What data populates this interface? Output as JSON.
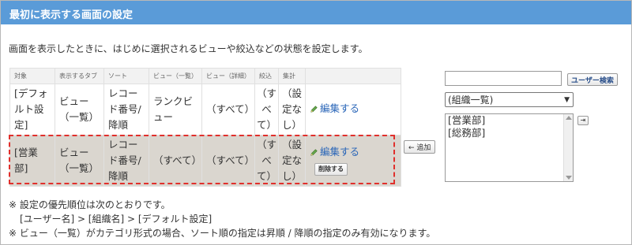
{
  "header": {
    "title": "最初に表示する画面の設定"
  },
  "intro": "画面を表示したときに、はじめに選択されるビューや絞込などの状態を設定します。",
  "table": {
    "columns": [
      "対象",
      "表示するタブ",
      "ソート",
      "ビュー（一覧）",
      "ビュー（詳細）",
      "絞込",
      "集計"
    ],
    "rows": [
      {
        "target": "[デフォルト設定]",
        "tab": "ビュー（一覧）",
        "sort": "レコード番号/ 降順",
        "view_list": "ランクビュー",
        "view_detail": "（すべて）",
        "filter": "（すべて）",
        "aggregate": "（設定なし）",
        "edit": "編集する"
      },
      {
        "target": "[営業部]",
        "tab": "ビュー（一覧）",
        "sort": "レコード番号/ 降順",
        "view_list": "（すべて）",
        "view_detail": "（すべて）",
        "filter": "（すべて）",
        "aggregate": "（設定なし）",
        "edit": "編集する",
        "delete": "削除する"
      }
    ]
  },
  "add_button": "← 追加",
  "user_search": {
    "value": "",
    "button": "ユーザー検索"
  },
  "org_select": {
    "selected": "(組織一覧)"
  },
  "org_list": {
    "items": [
      "[営業部]",
      "[総務部]"
    ]
  },
  "notes": {
    "line1": "※ 設定の優先順位は次のとおりです。",
    "line2": "[ユーザー名] > [組織名] > [デフォルト設定]",
    "line3": "※ ビュー（一覧）がカテゴリ形式の場合、ソート順の指定は昇順 / 降順の指定のみ有効になります。"
  },
  "colors": {
    "header_bg": "#5a9bd8",
    "highlight_border": "#e0302c",
    "link": "#2a66b8",
    "selected_row_bg": "#dad6cf"
  }
}
